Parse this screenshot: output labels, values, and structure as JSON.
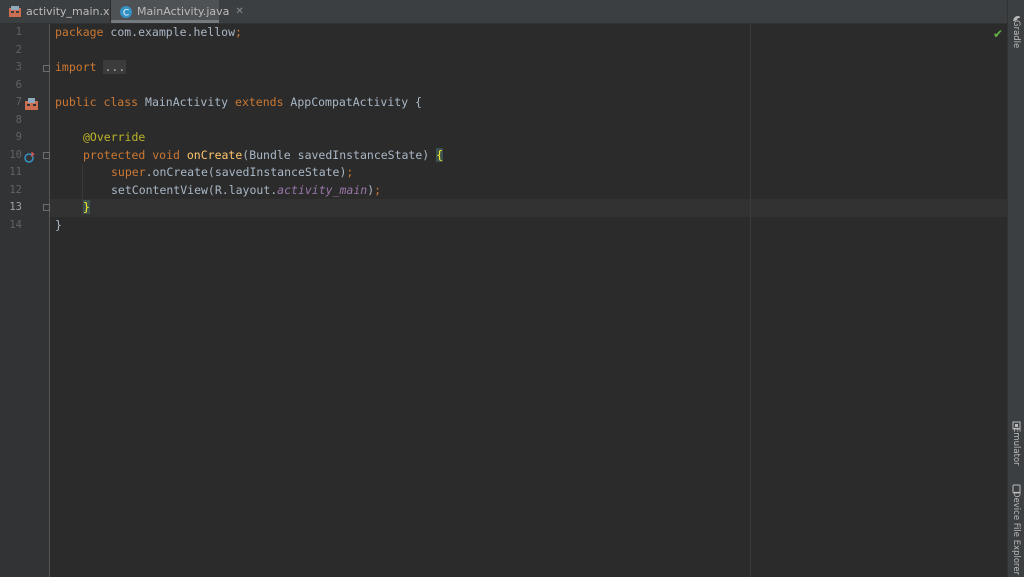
{
  "tabs": [
    {
      "label": "activity_main.xml",
      "icon": "layout-file-icon",
      "active": false
    },
    {
      "label": "MainActivity.java",
      "icon": "java-class-icon",
      "active": true
    }
  ],
  "line_numbers": [
    "1",
    "2",
    "3",
    "6",
    "7",
    "8",
    "9",
    "10",
    "11",
    "12",
    "13",
    "14"
  ],
  "current_line": "13",
  "code": {
    "l1_kw": "package",
    "l1_rest": " com.example.hellow",
    "l1_semi": ";",
    "l3_kw": "import",
    "l3_fold": "...",
    "l7_kw": "public class",
    "l7_name": " MainActivity ",
    "l7_kw2": "extends",
    "l7_rest": " AppCompatActivity {",
    "l9_ann": "@Override",
    "l10_kw": "protected void",
    "l10_fn": "onCreate",
    "l10_rest": "(Bundle savedInstanceState) ",
    "l10_brace": "{",
    "l11_kw": "super",
    "l11_rest": ".onCreate(savedInstanceState)",
    "l11_semi": ";",
    "l12_rest": "setContentView(R.layout.",
    "l12_it": "activity_main",
    "l12_end": ")",
    "l12_semi": ";",
    "l13_brace": "}",
    "l14": "}"
  },
  "right_panel": {
    "gradle": "Gradle",
    "emulator": "Emulator",
    "device_file_explorer": "Device File Explorer"
  },
  "colors": {
    "keyword": "#cc7832",
    "annotation": "#bbb529",
    "method": "#ffc66d",
    "field": "#9876aa",
    "text": "#a9b7c6"
  }
}
